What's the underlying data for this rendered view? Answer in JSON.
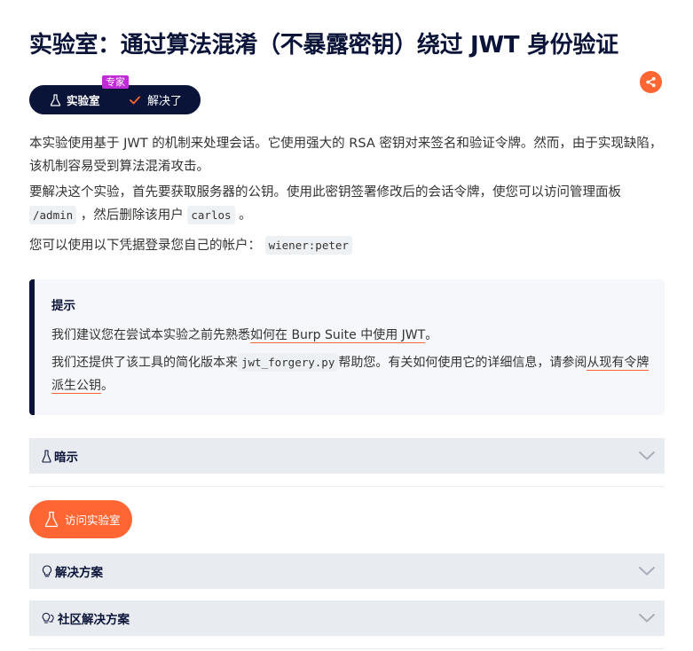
{
  "title": "实验室：通过算法混淆（不暴露密钥）绕过 JWT 身份验证",
  "badge": {
    "lab_label": "实验室",
    "level_label": "专家",
    "status_label": "解决了"
  },
  "description": {
    "p1": "本实验使用基于 JWT 的机制来处理会话。它使用强大的 RSA 密钥对来签名和验证令牌。然而，由于实现缺陷，该机制容易受到算法混淆攻击。",
    "p2_before": "要解决这个实验，首先要获取服务器的公钥。使用此密钥签署修改后的会话令牌，使您可以访问管理面板",
    "p2_code1": "/admin",
    "p2_middle": "，然后删除该用户",
    "p2_code2": "carlos",
    "p2_after": "。",
    "p3_before": "您可以使用以下凭据登录您自己的帐户：",
    "p3_code": "wiener:peter"
  },
  "hint_box": {
    "title": "提示",
    "p1_before": "我们建议您在尝试本实验之前先熟悉",
    "p1_link": "如何在 Burp Suite 中使用 JWT",
    "p1_after": "。",
    "p2_before": "我们还提供了该工具的简化版本来",
    "p2_code": "jwt_forgery.py",
    "p2_middle": "帮助您。有关如何使用它的详细信息，请参阅",
    "p2_link": "从现有令牌派生公钥",
    "p2_after": "。"
  },
  "sections": {
    "hint_label": "暗示",
    "access_lab_label": "访问实验室",
    "solution_label": "解决方案",
    "community_label": "社区解决方案"
  },
  "colors": {
    "navy": "#0a1338",
    "orange": "#ff6633",
    "purple": "#c12bd8",
    "panel": "#e8ebef"
  }
}
